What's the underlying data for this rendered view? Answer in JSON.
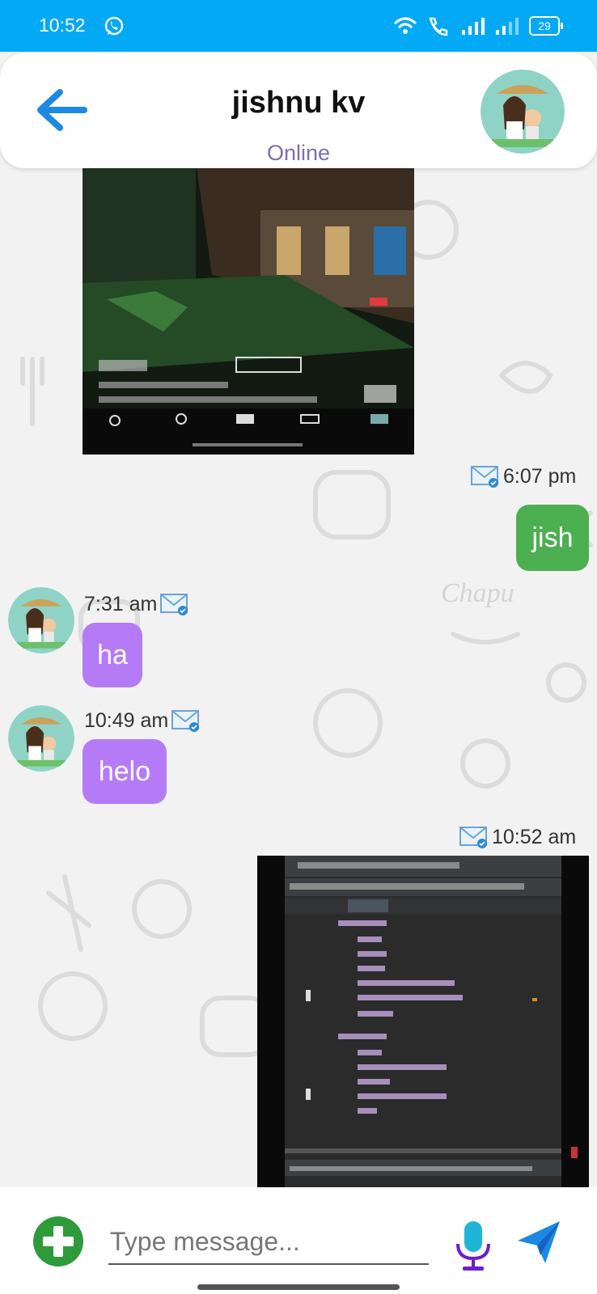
{
  "status_bar": {
    "time": "10:52",
    "battery": "29"
  },
  "header": {
    "contact_name": "jishnu kv",
    "status": "Online"
  },
  "messages": [
    {
      "type": "image",
      "direction": "incoming"
    },
    {
      "type": "text",
      "direction": "outgoing",
      "time": "6:07 pm",
      "text": "jish"
    },
    {
      "type": "text",
      "direction": "incoming",
      "time": "7:31 am",
      "text": "ha"
    },
    {
      "type": "text",
      "direction": "incoming",
      "time": "10:49 am",
      "text": "helo"
    },
    {
      "type": "image",
      "direction": "outgoing",
      "time": "10:52 am"
    }
  ],
  "composer": {
    "placeholder": "Type message..."
  },
  "colors": {
    "status_bar": "#03a9f4",
    "outgoing_bubble": "#4caf50",
    "incoming_bubble": "#b57bf7",
    "status_text": "#7a6fb0"
  }
}
